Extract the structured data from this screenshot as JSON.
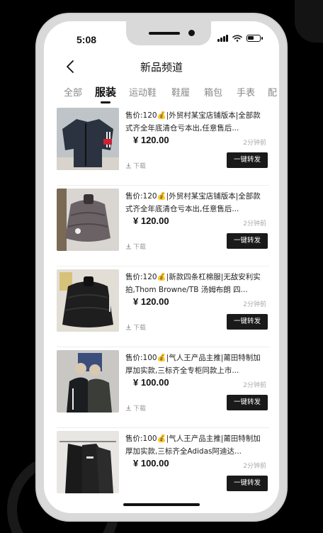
{
  "status": {
    "time": "5:08"
  },
  "nav": {
    "title": "新品频道"
  },
  "tabs": [
    "全部",
    "服装",
    "运动鞋",
    "鞋履",
    "箱包",
    "手表",
    "配"
  ],
  "items": [
    {
      "title": "售价:120💰|外贸村某宝店铺版本|全部款式齐全年底清仓亏本出,任意售后...",
      "price": "¥ 120.00",
      "time_ago": "2分钟前",
      "download": "下载",
      "share": "一键转发"
    },
    {
      "title": "售价:120💰|外贸村某宝店铺版本|全部款式齐全年底清仓亏本出,任意售后...",
      "price": "¥ 120.00",
      "time_ago": "2分钟前",
      "download": "下载",
      "share": "一键转发"
    },
    {
      "title": "售价:120💰|新款四条杠棉服|无敌安利实拍,Thom Browne/TB 汤姆布朗 四...",
      "price": "¥ 120.00",
      "time_ago": "2分钟前",
      "download": "下载",
      "share": "一键转发"
    },
    {
      "title": "售价:100💰|气人王产品主推|莆田特制加厚加实款,三标齐全专柜同款上市...",
      "price": "¥ 100.00",
      "time_ago": "2分钟前",
      "download": "下载",
      "share": "一键转发"
    },
    {
      "title": "售价:100💰|气人王产品主推|莆田特制加厚加实款,三标齐全Adidas阿迪达...",
      "price": "¥ 100.00",
      "time_ago": "2分钟前",
      "download": "下载",
      "share": "一键转发"
    }
  ]
}
